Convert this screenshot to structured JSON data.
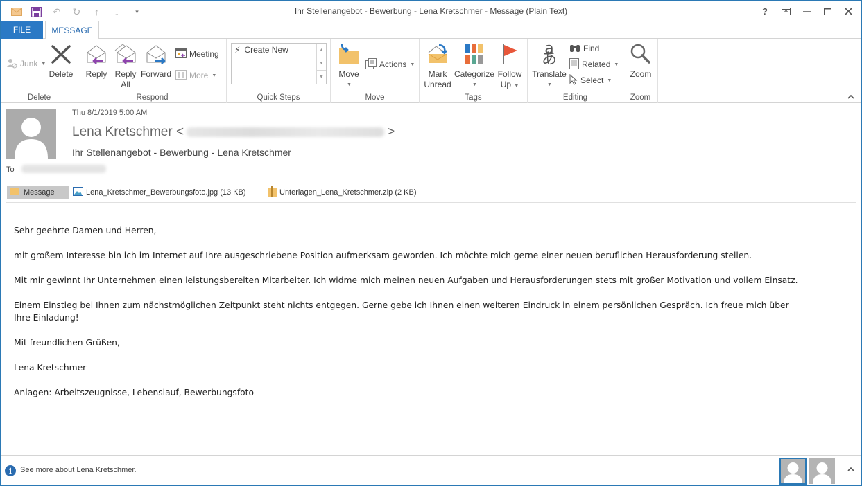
{
  "window": {
    "title": "Ihr Stellenangebot - Bewerbung - Lena Kretschmer - Message (Plain Text)",
    "controls": {
      "help": "?",
      "restore_ribbon": "ribbon-display-options",
      "minimize": "minimize",
      "maximize": "maximize",
      "close": "close"
    }
  },
  "quick_access": [
    "mail-icon",
    "save-icon",
    "undo-icon",
    "redo-icon",
    "previous-item-icon",
    "next-item-icon",
    "customize-icon"
  ],
  "tabs": {
    "file": "FILE",
    "message": "MESSAGE"
  },
  "ribbon": {
    "delete_group": {
      "label": "Delete",
      "junk": "Junk",
      "delete": "Delete"
    },
    "respond_group": {
      "label": "Respond",
      "reply": "Reply",
      "reply_all_1": "Reply",
      "reply_all_2": "All",
      "forward": "Forward",
      "meeting": "Meeting",
      "more": "More"
    },
    "quick_steps_group": {
      "label": "Quick Steps",
      "items": [
        "Create New"
      ]
    },
    "move_group": {
      "label": "Move",
      "move": "Move",
      "actions": "Actions"
    },
    "tags_group": {
      "label": "Tags",
      "mark_unread_1": "Mark",
      "mark_unread_2": "Unread",
      "categorize": "Categorize",
      "follow_up_1": "Follow",
      "follow_up_2": "Up"
    },
    "editing_group": {
      "label": "Editing",
      "translate": "Translate",
      "find": "Find",
      "related": "Related",
      "select": "Select"
    },
    "zoom_group": {
      "label": "Zoom",
      "zoom": "Zoom"
    }
  },
  "message": {
    "date": "Thu 8/1/2019 5:00 AM",
    "sender_name": "Lena Kretschmer",
    "sender_open": "<",
    "sender_close": ">",
    "subject": "Ihr Stellenangebot - Bewerbung - Lena Kretschmer",
    "to_label": "To",
    "attachments": [
      {
        "label": "Message",
        "type": "message"
      },
      {
        "label": "Lena_Kretschmer_Bewerbungsfoto.jpg (13 KB)",
        "type": "image"
      },
      {
        "label": "Unterlagen_Lena_Kretschmer.zip (2 KB)",
        "type": "zip"
      }
    ],
    "body": [
      "Sehr geehrte Damen und Herren,",
      "mit großem Interesse bin ich im Internet auf Ihre ausgeschriebene Position aufmerksam geworden. Ich möchte mich gerne einer neuen beruflichen Herausforderung stellen.",
      "Mit mir gewinnt Ihr Unternehmen einen leistungsbereiten Mitarbeiter. Ich widme mich meinen neuen Aufgaben und Herausforderungen stets mit großer Motivation und vollem Einsatz.",
      "Einem Einstieg bei Ihnen zum nächstmöglichen Zeitpunkt steht nichts entgegen. Gerne gebe ich Ihnen einen weiteren Eindruck in einem persönlichen Gespräch. Ich freue mich über Ihre Einladung!",
      "Mit freundlichen Grüßen,",
      "Lena Kretschmer",
      "Anlagen: Arbeitszeugnisse, Lebenslauf, Bewerbungsfoto"
    ]
  },
  "footer": {
    "see_more": "See more about Lena Kretschmer."
  },
  "colors": {
    "accent": "#2b79c5",
    "frame": "#2b79b5",
    "avatar_bg": "#ababab"
  }
}
